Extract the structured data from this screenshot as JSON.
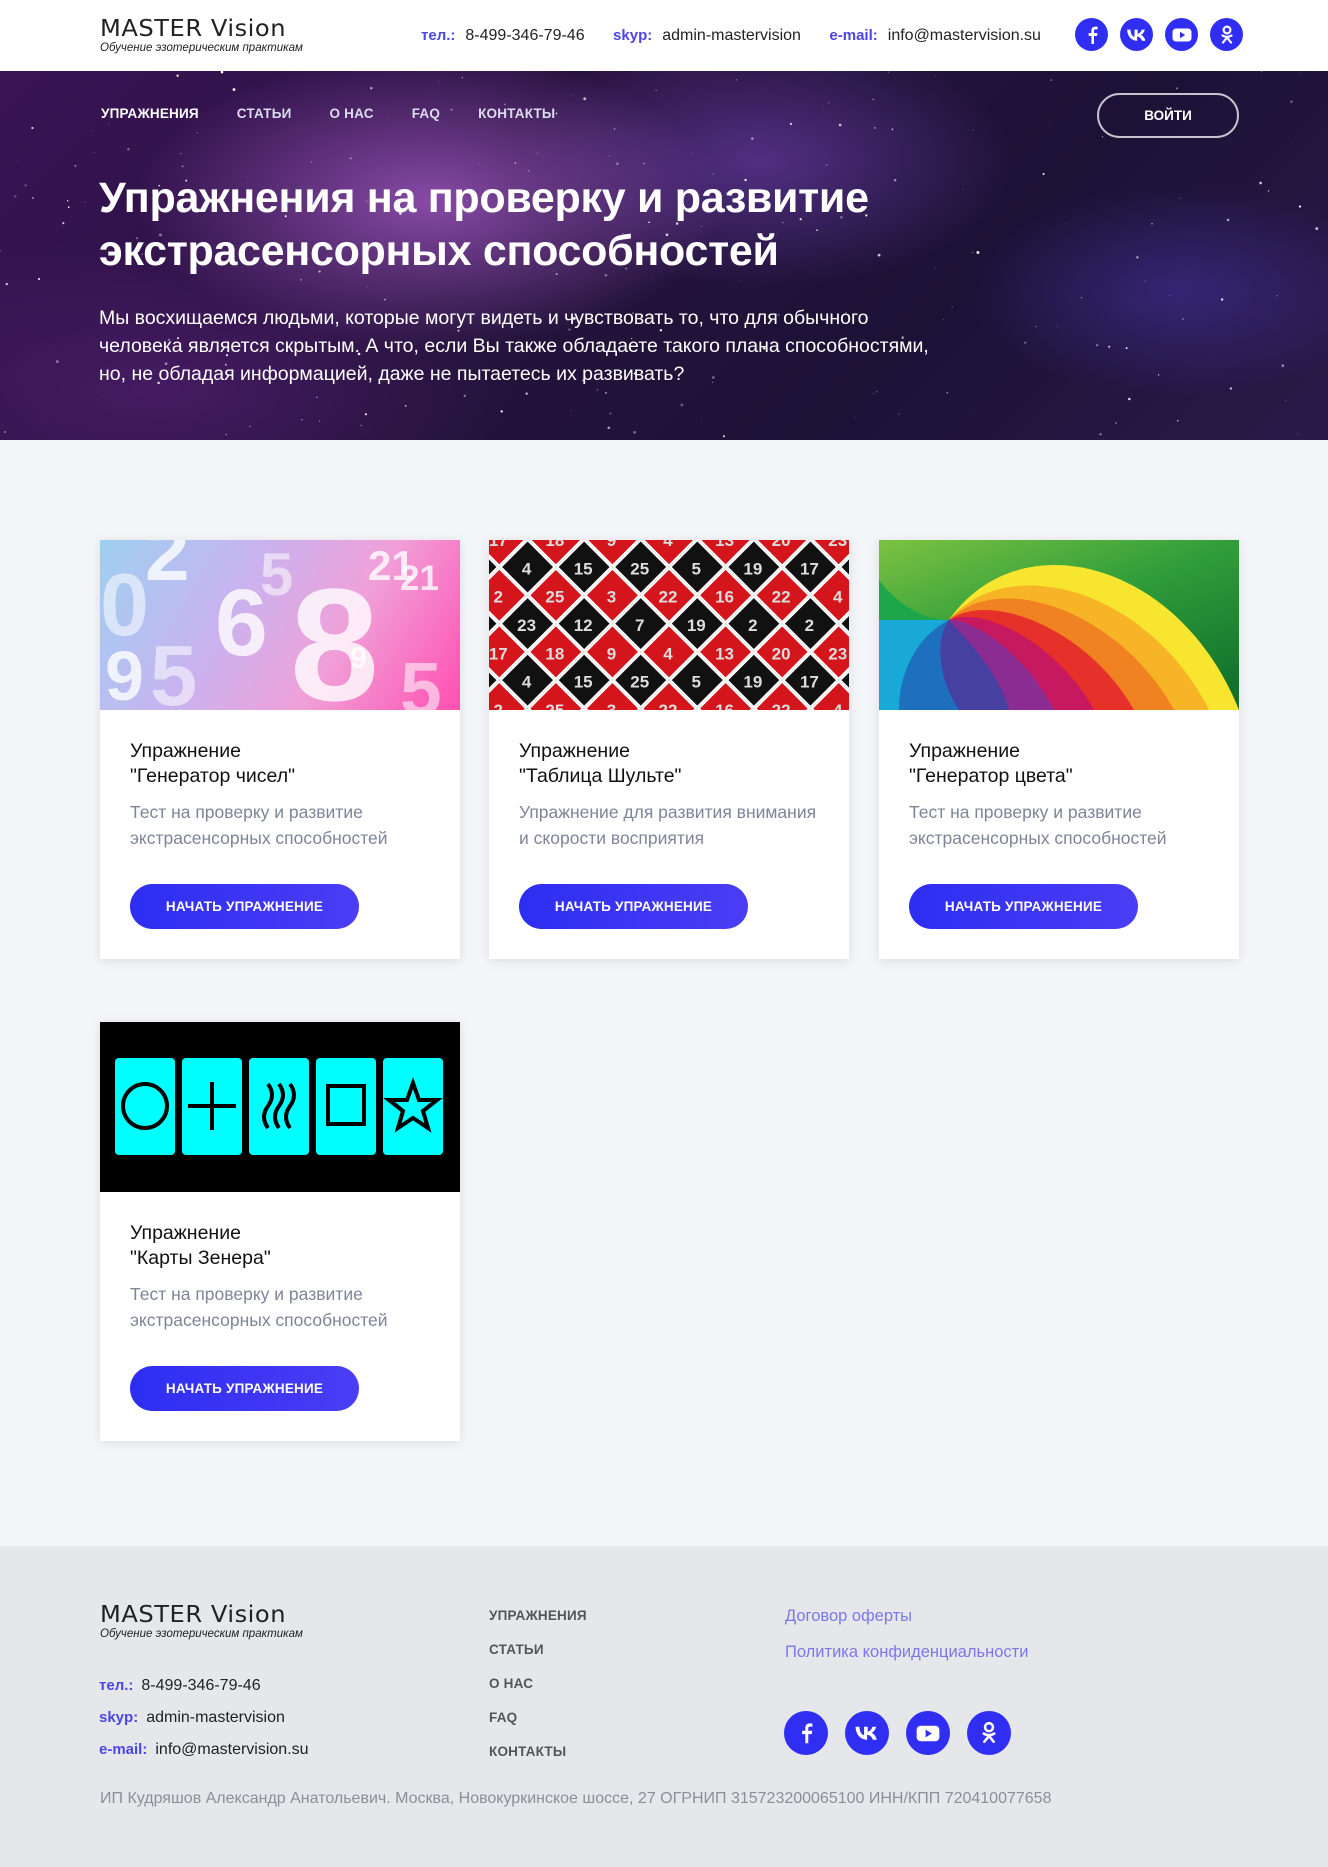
{
  "header": {
    "logo_title": "MASTER Vision",
    "logo_subtitle": "Обучение эзотерическим практикам",
    "contacts": [
      {
        "label": "тел.:",
        "value": "8-499-346-79-46"
      },
      {
        "label": "skyp:",
        "value": "admin-mastervision"
      },
      {
        "label": "e-mail:",
        "value": "info@mastervision.su"
      }
    ],
    "socials": [
      "facebook-icon",
      "vk-icon",
      "youtube-icon",
      "odnoklassniki-icon"
    ]
  },
  "nav": {
    "items": [
      "УПРАЖНЕНИЯ",
      "СТАТЬИ",
      "О НАС",
      "FAQ",
      "КОНТАКТЫ"
    ],
    "active": "УПРАЖНЕНИЯ",
    "login_label": "ВОЙТИ"
  },
  "hero": {
    "title": "Упражнения на проверку и развитие экстрасенсорных способностей",
    "text": "Мы восхищаемся людьми, которые могут видеть и чувствовать то, что для обычного человека является скрытым. А что, если Вы также обладаете такого плана способностями, но, не обладая информацией, даже не пытаетесь их развивать?"
  },
  "cards": [
    {
      "title_line1": "Упражнение",
      "title_line2": "\"Генератор чисел\"",
      "desc": "Тест на проверку и развитие экстрасенсорных способностей",
      "button": "НАЧАТЬ УПРАЖНЕНИЕ",
      "image": "numbers-image"
    },
    {
      "title_line1": "Упражнение",
      "title_line2": "\"Таблица Шульте\"",
      "desc": "Упражнение для развития внимания и скорости восприятия",
      "button": "НАЧАТЬ УПРАЖНЕНИЕ",
      "image": "schulte-table-image"
    },
    {
      "title_line1": "Упражнение",
      "title_line2": "\"Генератор цвета\"",
      "desc": "Тест на проверку и развитие экстрасенсорных способностей",
      "button": "НАЧАТЬ УПРАЖНЕНИЕ",
      "image": "rainbow-spiral-image"
    },
    {
      "title_line1": "Упражнение",
      "title_line2": "\"Карты Зенера\"",
      "desc": "Тест на проверку и развитие экстрасенсорных способностей",
      "button": "НАЧАТЬ УПРАЖНЕНИЕ",
      "image": "zener-cards-image"
    }
  ],
  "schulte_numbers": [
    "22",
    "19",
    "13",
    "19",
    "22",
    "2",
    "23",
    "18",
    "15",
    "3",
    "7",
    "4",
    "5",
    "16",
    "2",
    "20",
    "17",
    "4",
    "25",
    "12",
    "9",
    "25"
  ],
  "number_image_digits": [
    "0",
    "2",
    "9",
    "5",
    "6",
    "8",
    "5",
    "21",
    "9",
    "5",
    "21"
  ],
  "footer": {
    "logo_title": "MASTER Vision",
    "logo_subtitle": "Обучение эзотерическим практикам",
    "contacts": [
      {
        "label": "тел.:",
        "value": "8-499-346-79-46"
      },
      {
        "label": "skyp:",
        "value": "admin-mastervision"
      },
      {
        "label": "e-mail:",
        "value": "info@mastervision.su"
      }
    ],
    "nav": [
      "УПРАЖНЕНИЯ",
      "СТАТЬИ",
      "О НАС",
      "FAQ",
      "КОНТАКТЫ"
    ],
    "links": [
      "Договор оферты",
      "Политика конфиденциальности"
    ],
    "legal": "ИП Кудряшов Александр Анатольевич. Москва, Новокуркинское шоссе, 27 ОГРНИП 315723200065100 ИНН/КПП 720410077658"
  },
  "colors": {
    "accent": "#2f2ef2",
    "link": "#7a78e8",
    "label": "#4b46e8",
    "zener_card": "#00ffff"
  }
}
